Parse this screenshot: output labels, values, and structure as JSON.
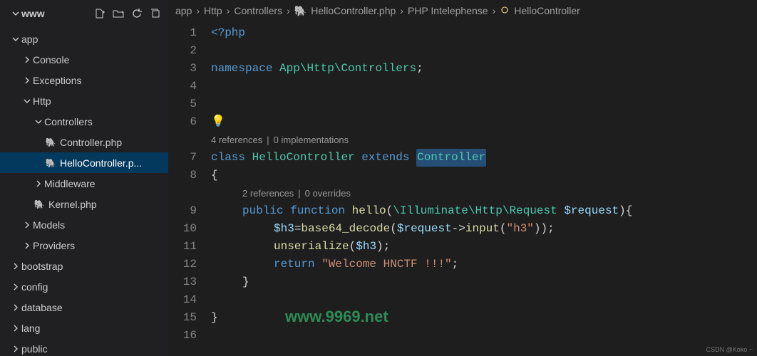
{
  "explorer": {
    "root": "www",
    "tree": {
      "app": "app",
      "console": "Console",
      "exceptions": "Exceptions",
      "http": "Http",
      "controllers": "Controllers",
      "controller_php": "Controller.php",
      "hello_controller_php": "HelloController.p...",
      "middleware": "Middleware",
      "kernel_php": "Kernel.php",
      "models": "Models",
      "providers": "Providers",
      "bootstrap": "bootstrap",
      "config": "config",
      "database": "database",
      "lang": "lang",
      "public": "public"
    }
  },
  "breadcrumb": {
    "seg1": "app",
    "seg2": "Http",
    "seg3": "Controllers",
    "seg4": "HelloController.php",
    "seg5": "PHP Intelephense",
    "seg6": "HelloController"
  },
  "codelens": {
    "class_refs": "4 references",
    "class_impl": "0 implementations",
    "method_refs": "2 references",
    "method_over": "0 overrides"
  },
  "code": {
    "l1_open": "<?php",
    "l3_ns_kw": "namespace",
    "l3_ns_path": "App\\Http\\Controllers",
    "l3_semi": ";",
    "l7_class": "class",
    "l7_name": "HelloController",
    "l7_extends": "extends",
    "l7_parent": "Controller",
    "l8_brace": "{",
    "l9_public": "public",
    "l9_function": "function",
    "l9_name": "hello",
    "l9_paren_open": "(",
    "l9_ns": "\\Illuminate\\Http\\",
    "l9_type": "Request",
    "l9_arg": "$request",
    "l9_close": "){",
    "l10_var": "$h3",
    "l10_eq": " = ",
    "l10_fn": "base64_decode",
    "l10_po": "(",
    "l10_req": "$request",
    "l10_arrow": "->",
    "l10_input": "input",
    "l10_po2": "(",
    "l10_str": "\"h3\"",
    "l10_pc": "));",
    "l11_fn": "unserialize",
    "l11_po": "(",
    "l11_arg": "$h3",
    "l11_pc": ");",
    "l12_ret": "return",
    "l12_str": "\"Welcome HNCTF !!!\"",
    "l12_semi": ";",
    "l13_brace": "}",
    "l15_brace": "}"
  },
  "gutter": {
    "1": "1",
    "2": "2",
    "3": "3",
    "4": "4",
    "5": "5",
    "6": "6",
    "7": "7",
    "8": "8",
    "9": "9",
    "10": "10",
    "11": "11",
    "12": "12",
    "13": "13",
    "14": "14",
    "15": "15",
    "16": "16"
  },
  "watermark": "www.9969.net",
  "corner": "CSDN @Koko ~"
}
